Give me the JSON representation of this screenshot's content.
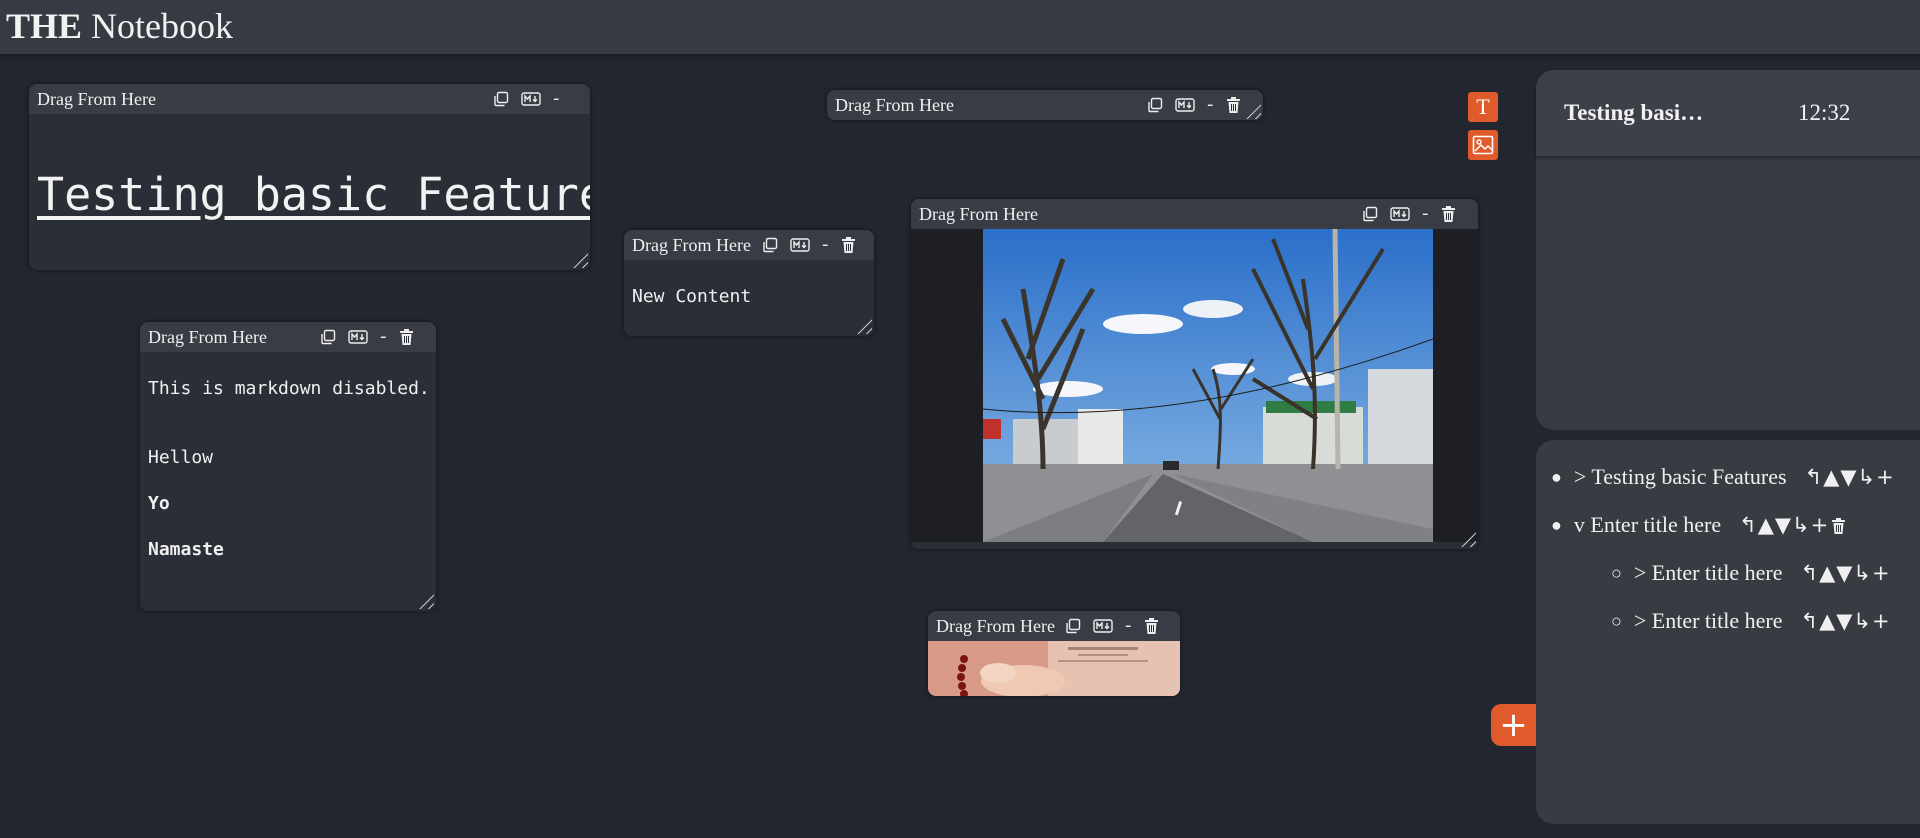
{
  "app": {
    "title_bold": "THE",
    "title_rest": " Notebook"
  },
  "card_drag_label": "Drag From Here",
  "cards": {
    "title_card": {
      "heading": "Testing basic Features"
    },
    "md_card": {
      "lines": [
        "This is markdown disabled.",
        "Hellow",
        "Yo",
        "Namaste"
      ]
    },
    "content_card": {
      "text": "New Content"
    }
  },
  "tools": {
    "minus": "-"
  },
  "sidebar": {
    "note_title": "Testing basi…",
    "time": "12:32",
    "outline": [
      {
        "label": "> Testing basic Features",
        "level": 0,
        "bullet": "●"
      },
      {
        "label": "v Enter title here",
        "level": 0,
        "bullet": "●"
      },
      {
        "label": "> Enter title here",
        "level": 1,
        "bullet": "○"
      },
      {
        "label": "> Enter title here",
        "level": 1,
        "bullet": "○"
      }
    ],
    "controls": {
      "up_level": "↰",
      "move_up": "▲",
      "move_down": "▼",
      "down_level": "↳",
      "add": "+"
    }
  },
  "buttons": {
    "text_tool": "T",
    "add": "+"
  },
  "colors": {
    "accent": "#e15a2b",
    "background": "#22262f",
    "card": "#2a2e36",
    "card_header": "#393c44"
  }
}
